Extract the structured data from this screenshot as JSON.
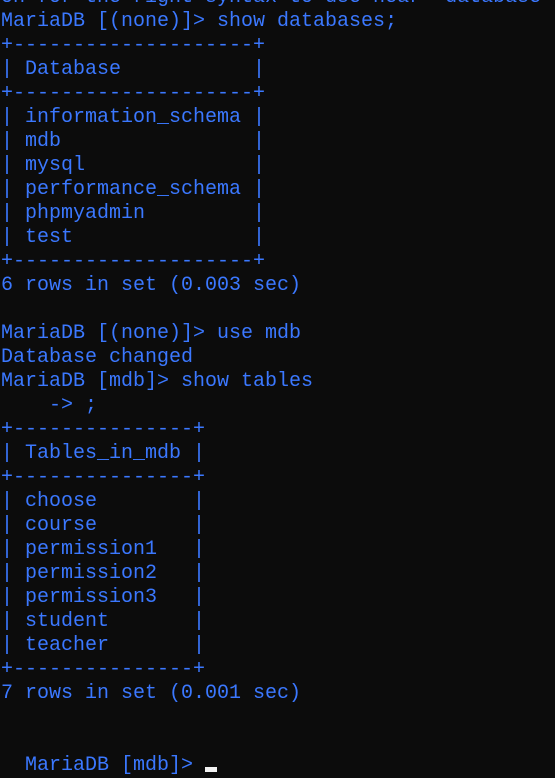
{
  "lines": [
    "on for the right syntax to use near 'database",
    "MariaDB [(none)]> show databases;",
    "+--------------------+",
    "| Database           |",
    "+--------------------+",
    "| information_schema |",
    "| mdb                |",
    "| mysql              |",
    "| performance_schema |",
    "| phpmyadmin         |",
    "| test               |",
    "+--------------------+",
    "6 rows in set (0.003 sec)",
    "",
    "MariaDB [(none)]> use mdb",
    "Database changed",
    "MariaDB [mdb]> show tables",
    "    -> ;",
    "+---------------+",
    "| Tables_in_mdb |",
    "+---------------+",
    "| choose        |",
    "| course        |",
    "| permission1   |",
    "| permission2   |",
    "| permission3   |",
    "| student       |",
    "| teacher       |",
    "+---------------+",
    "7 rows in set (0.001 sec)",
    ""
  ],
  "prompt": "MariaDB [mdb]>",
  "colors": {
    "text": "#3b78ff",
    "background": "#0c0c0c",
    "cursor": "#f2f2f2"
  }
}
